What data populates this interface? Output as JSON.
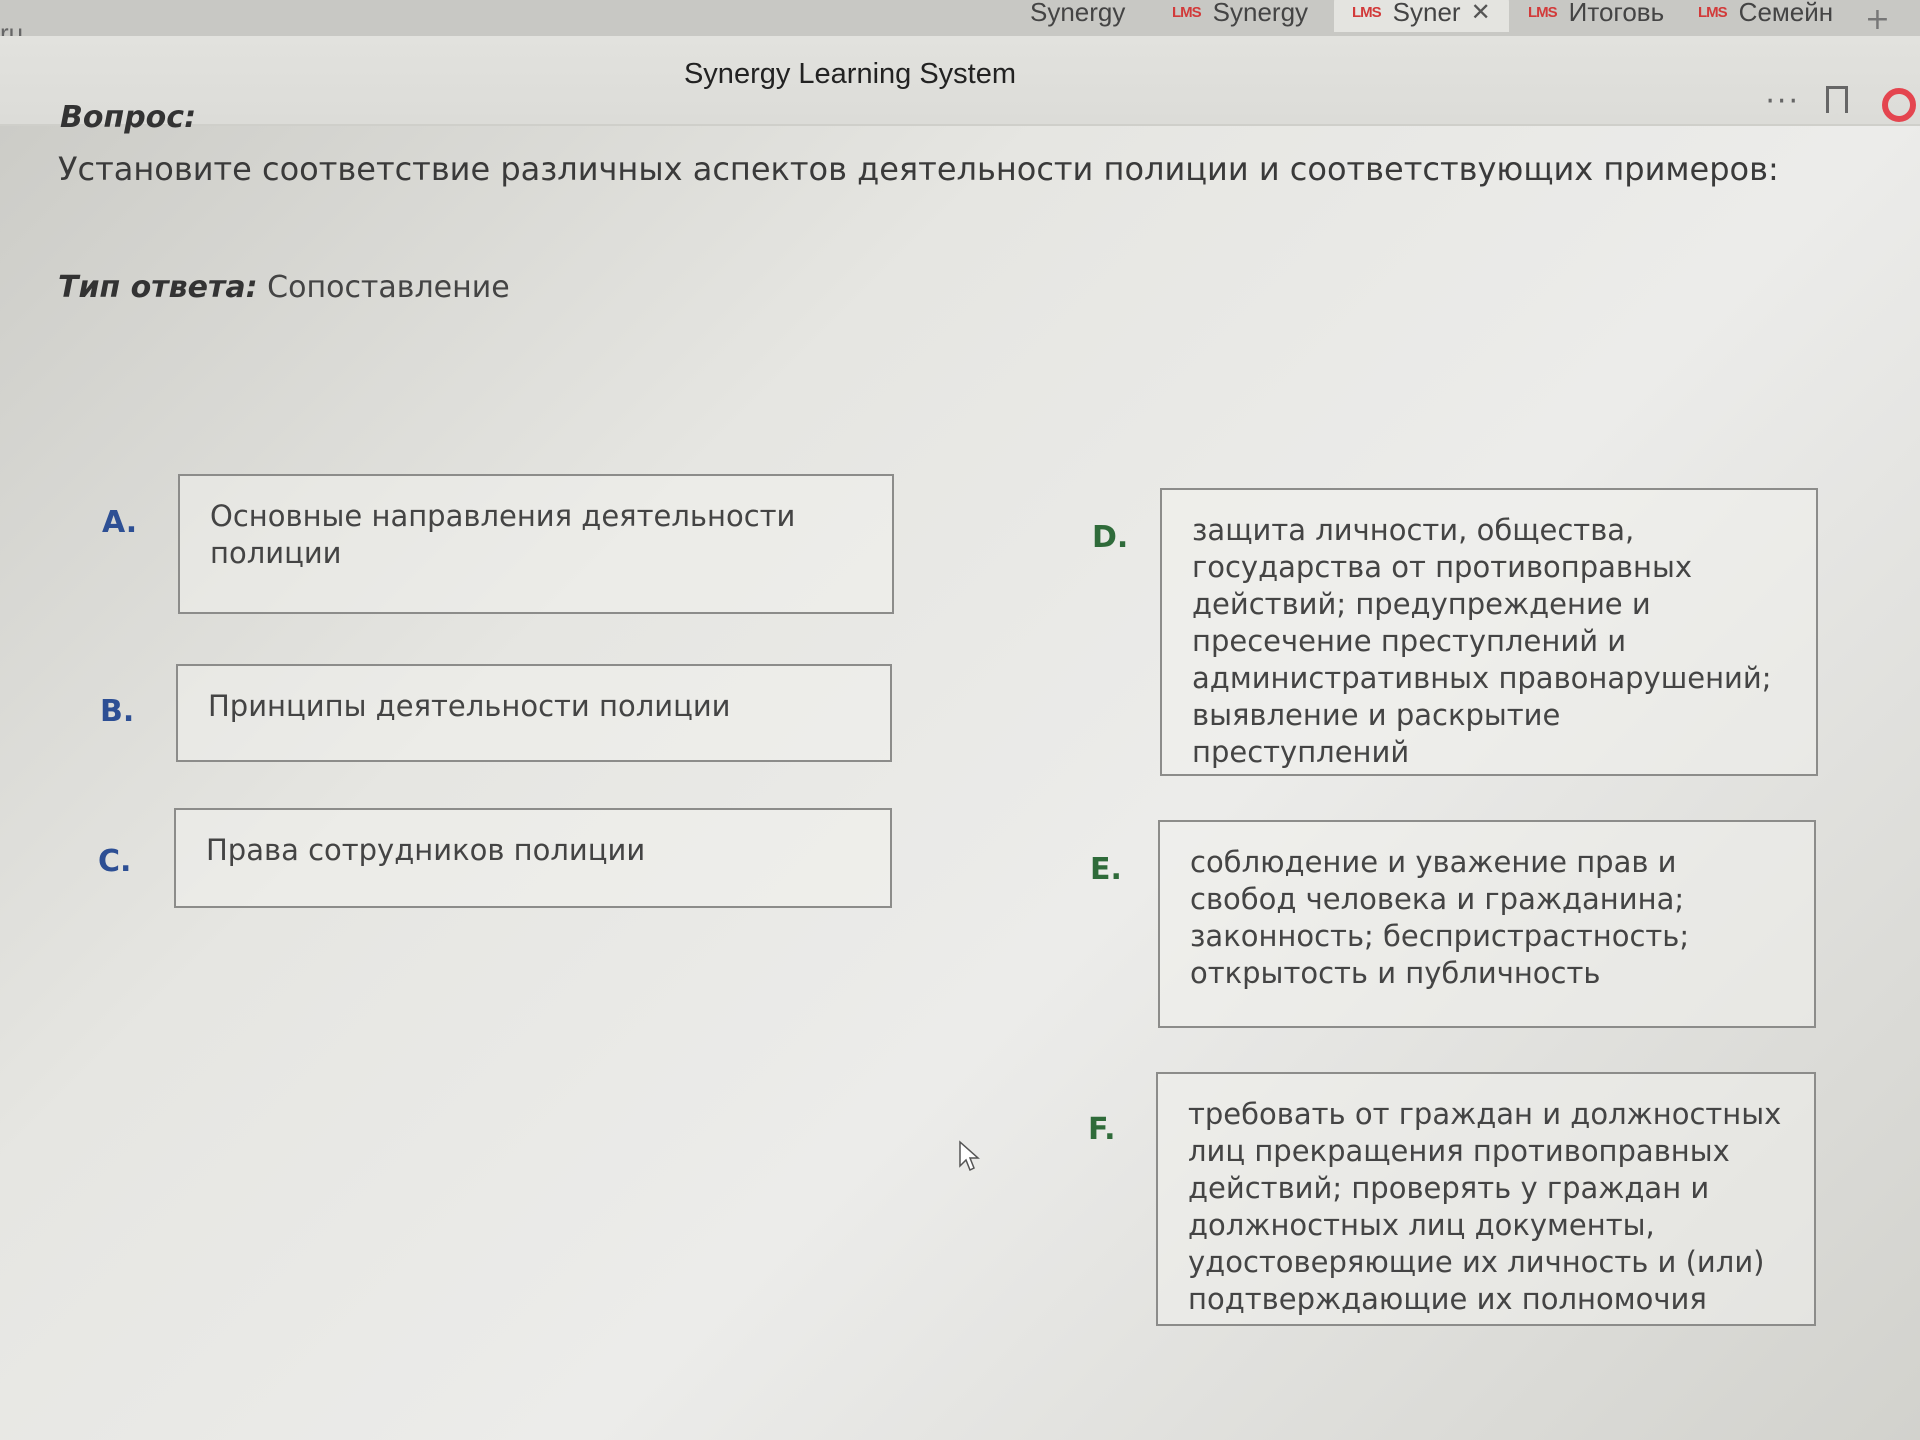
{
  "browser": {
    "url_fragment": "ru",
    "tabs": [
      {
        "label": "Synergy",
        "lms": false
      },
      {
        "label": "Synergy",
        "lms": true
      },
      {
        "label": "Syner",
        "lms": true,
        "active": true
      },
      {
        "label": "Итоговь",
        "lms": true
      },
      {
        "label": "Семейн",
        "lms": true
      }
    ],
    "lms_badge": "LMS",
    "close_glyph": "✕",
    "new_tab_glyph": "+",
    "menu_glyph": "···",
    "page_title": "Synergy Learning System"
  },
  "question": {
    "label": "Вопрос:",
    "text": "Установите соответствие различных аспектов деятельности полиции и соответствующих примеров:",
    "answer_type_label": "Тип ответа:",
    "answer_type_value": "Сопоставление"
  },
  "left_items": [
    {
      "letter": "A.",
      "text": "Основные направления деятельности полиции"
    },
    {
      "letter": "B.",
      "text": "Принципы деятельности полиции"
    },
    {
      "letter": "C.",
      "text": "Права сотрудников полиции"
    }
  ],
  "right_items": [
    {
      "letter": "D.",
      "text": "защита личности, общества, государства от противоправных действий; предупреждение и пресечение преступлений и административных правонарушений; выявление и раскрытие преступлений"
    },
    {
      "letter": "E.",
      "text": "соблюдение и уважение прав и свобод человека и гражданина; законность; беспристрастность; открытость и публичность"
    },
    {
      "letter": "F.",
      "text": "требовать от граждан и должностных лиц прекращения противоправных действий; проверять у граждан и должностных лиц документы, удостоверяющие их личность и (или) подтверждающие их полномочия"
    }
  ],
  "colors": {
    "left_letter": "#2d4f94",
    "right_letter": "#2f6b3a",
    "lms_badge": "#d23a3a",
    "record": "#e4454f"
  }
}
